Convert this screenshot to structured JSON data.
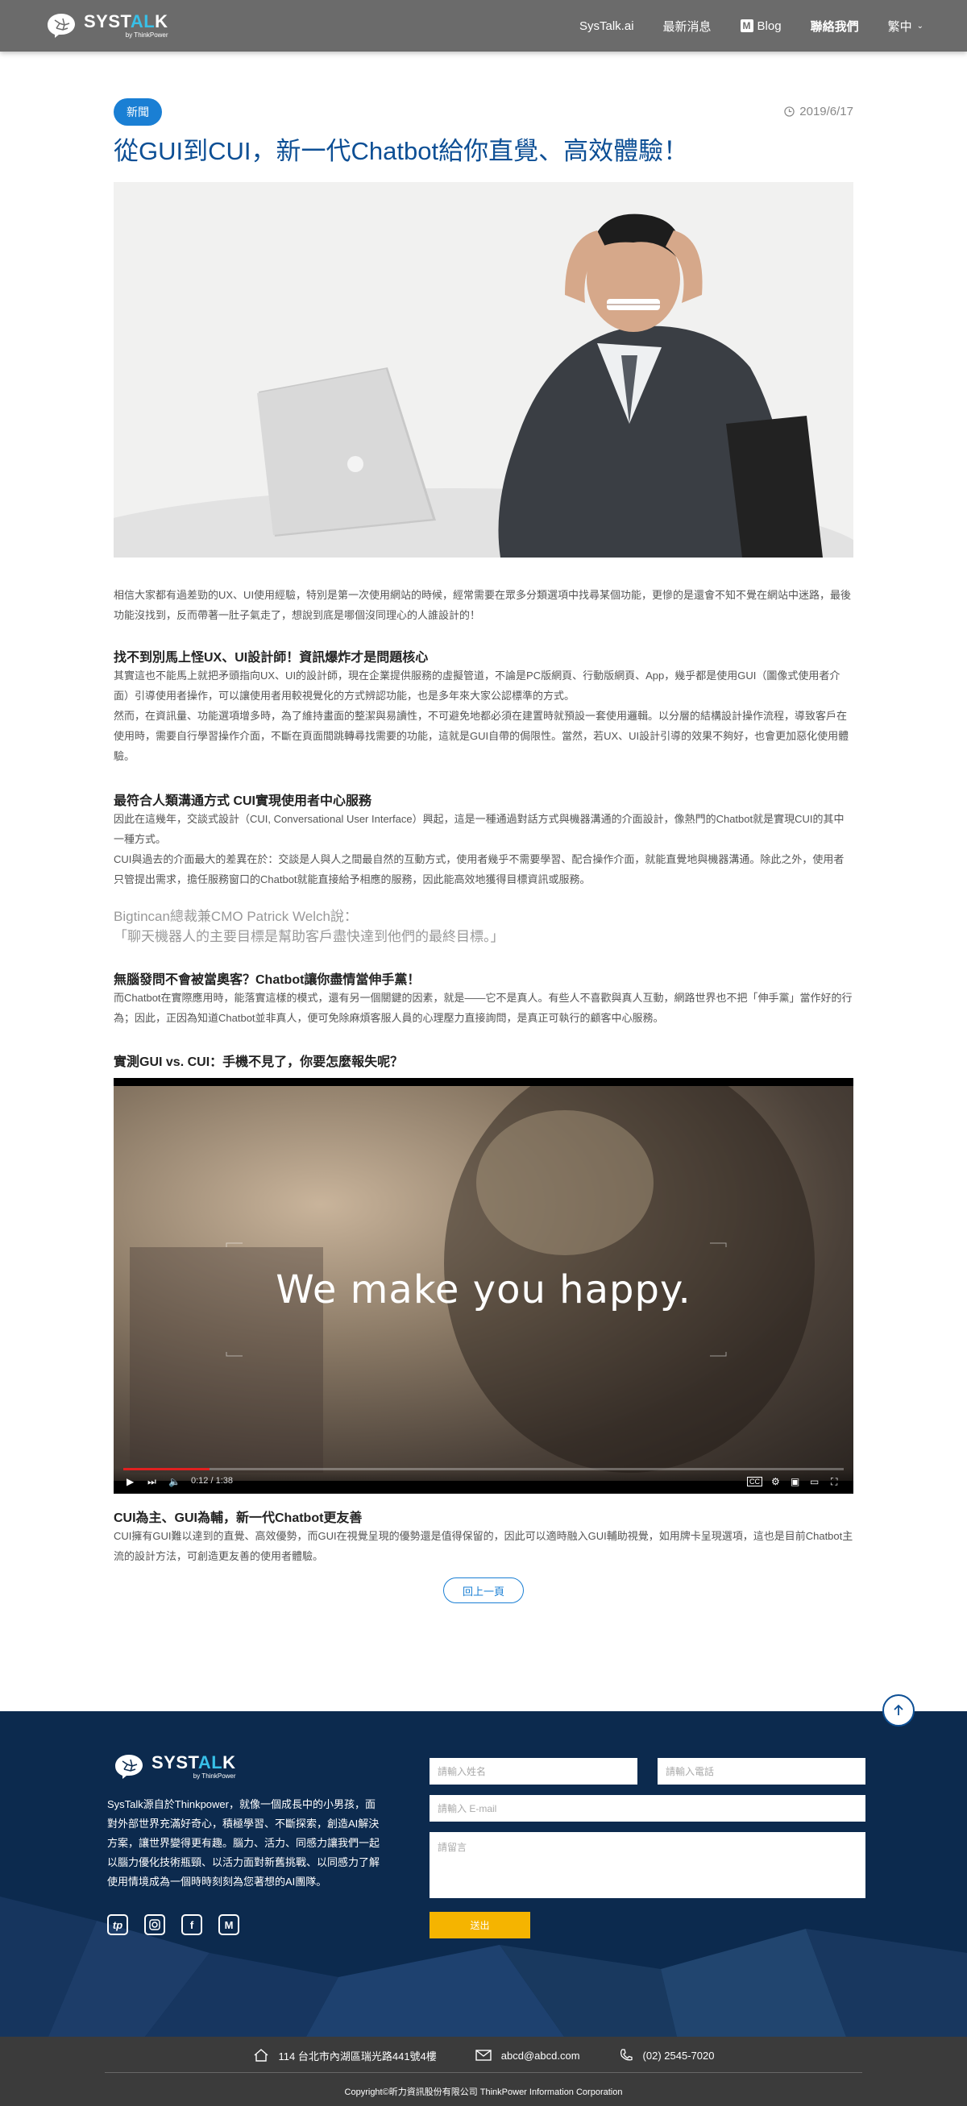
{
  "header": {
    "logo_text_main_a": "SYST",
    "logo_text_main_b": "AL",
    "logo_text_main_c": "K",
    "logo_sub": "by ThinkPower",
    "nav": [
      {
        "label": "SysTalk.ai"
      },
      {
        "label": "最新消息"
      },
      {
        "label": "Blog",
        "icon": "medium-icon"
      },
      {
        "label": "聯絡我們",
        "bold": true
      },
      {
        "label": "繁中",
        "icon": "chevron-down-icon"
      }
    ]
  },
  "article": {
    "badge": "新聞",
    "date": "2019/6/17",
    "title": "從GUI到CUI，新一代Chatbot給你直覺、高效體驗！",
    "intro": "相信大家都有過差勁的UX、UI使用經驗，特別是第一次使用網站的時候，經常需要在眾多分類選項中找尋某個功能，更慘的是還會不知不覺在網站中迷路，最後功能沒找到，反而帶著一肚子氣走了，想說到底是哪個沒同理心的人誰設計的！",
    "sections": [
      {
        "heading": "找不到別馬上怪UX、UI設計師！資訊爆炸才是問題核心",
        "paragraphs": [
          "其實這也不能馬上就把矛頭指向UX、UI的設計師，現在企業提供服務的虛擬管道，不論是PC版網頁、行動版網頁、App，幾乎都是使用GUI（圖像式使用者介面）引導使用者操作，可以讓使用者用較視覺化的方式辨認功能，也是多年來大家公認標準的方式。",
          "然而，在資訊量、功能選項增多時，為了維持畫面的整潔與易讀性，不可避免地都必須在建置時就預設一套使用邏輯。以分層的結構設計操作流程，導致客戶在使用時，需要自行學習操作介面，不斷在頁面間跳轉尋找需要的功能，這就是GUI自帶的侷限性。當然，若UX、UI設計引導的效果不夠好，也會更加惡化使用體驗。"
        ]
      },
      {
        "heading": "最符合人類溝通方式 CUI實現使用者中心服務",
        "paragraphs": [
          "因此在這幾年，交談式設計（CUI, Conversational User Interface）興起，這是一種通過對話方式與機器溝通的介面設計，像熱門的Chatbot就是實現CUI的其中一種方式。",
          "CUI與過去的介面最大的差異在於：交談是人與人之間最自然的互動方式，使用者幾乎不需要學習、配合操作介面，就能直覺地與機器溝通。除此之外，使用者只管提出需求，擔任服務窗口的Chatbot就能直接給予相應的服務，因此能高效地獲得目標資訊或服務。"
        ]
      }
    ],
    "quote_author": "Bigtincan總裁兼CMO Patrick Welch說：",
    "quote_text": "「聊天機器人的主要目標是幫助客戶盡快達到他們的最終目標。」",
    "section3_heading": "無腦發問不會被當奧客？Chatbot讓你盡情當伸手黨！",
    "section3_para": "而Chatbot在實際應用時，能落實這樣的模式，還有另一個關鍵的因素，就是——它不是真人。有些人不喜歡與真人互動，網路世界也不把「伸手黨」當作好的行為；因此，正因為知道Chatbot並非真人，便可免除麻煩客服人員的心理壓力直接詢問，是真正可執行的顧客中心服務。",
    "section4_heading": "實測GUI vs. CUI：手機不見了，你要怎麼報失呢？",
    "video": {
      "caption": "We make you happy.",
      "time": "0:12 / 1:38",
      "progress": 0.12
    },
    "section5_heading": "CUI為主、GUI為輔，新一代Chatbot更友善",
    "section5_para": "CUI擁有GUI難以達到的直覺、高效優勢，而GUI在視覺呈現的優勢還是值得保留的，因此可以適時融入GUI輔助視覺，如用牌卡呈現選項，這也是目前Chatbot主流的設計方法，可創造更友善的使用者體驗。",
    "back_label": "回上一頁"
  },
  "footer": {
    "about": "SysTalk源自於Thinkpower，就像一個成長中的小男孩，面對外部世界充滿好奇心，積極學習、不斷探索，創造AI解決方案，讓世界變得更有趣。腦力、活力、同感力讓我們一起以腦力優化技術瓶頸、以活力面對新舊挑戰、以同感力了解使用情境成為一個時時刻刻為您著想的AI團隊。",
    "social": [
      "tp-icon",
      "instagram-icon",
      "facebook-icon",
      "medium-icon"
    ],
    "form": {
      "name_placeholder": "請輸入姓名",
      "phone_placeholder": "請輸入電話",
      "email_placeholder": "請輸入 E-mail",
      "message_placeholder": "請留言",
      "submit_label": "送出"
    },
    "address": "114 台北市內湖區瑞光路441號4樓",
    "email": "abcd@abcd.com",
    "phone": "(02) 2545-7020",
    "copyright": "Copyright©昕力資訊股份有限公司 ThinkPower Information Corporation"
  }
}
